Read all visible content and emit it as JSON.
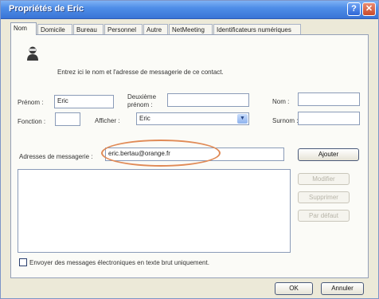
{
  "window": {
    "title": "Propriétés de Eric",
    "help_glyph": "?",
    "close_glyph": "✕"
  },
  "tabs": [
    {
      "label": "Nom",
      "active": true
    },
    {
      "label": "Domicile"
    },
    {
      "label": "Bureau"
    },
    {
      "label": "Personnel"
    },
    {
      "label": "Autre"
    },
    {
      "label": "NetMeeting"
    },
    {
      "label": "Identificateurs numériques"
    }
  ],
  "intro": "Entrez ici le nom et l'adresse de messagerie de ce contact.",
  "fields": {
    "prenom_label": "Prénom :",
    "prenom_value": "Eric",
    "deuxieme_label_line1": "Deuxième",
    "deuxieme_label_line2": "prénom :",
    "deuxieme_value": "",
    "nom_label": "Nom :",
    "nom_value": "",
    "fonction_label": "Fonction :",
    "fonction_value": "",
    "afficher_label": "Afficher :",
    "afficher_value": "Eric",
    "surnom_label": "Surnom :",
    "surnom_value": ""
  },
  "email": {
    "label": "Adresses de messagerie :",
    "value": "eric.bertau@orange.fr",
    "ajouter": "Ajouter",
    "modifier": "Modifier",
    "supprimer": "Supprimer",
    "par_defaut": "Par défaut"
  },
  "plain_text_checkbox": {
    "label": "Envoyer des messages électroniques en texte brut uniquement.",
    "checked": false
  },
  "footer": {
    "ok": "OK",
    "annuler": "Annuler"
  },
  "colors": {
    "titlebar": "#3974d6",
    "highlight": "#e08a56"
  }
}
